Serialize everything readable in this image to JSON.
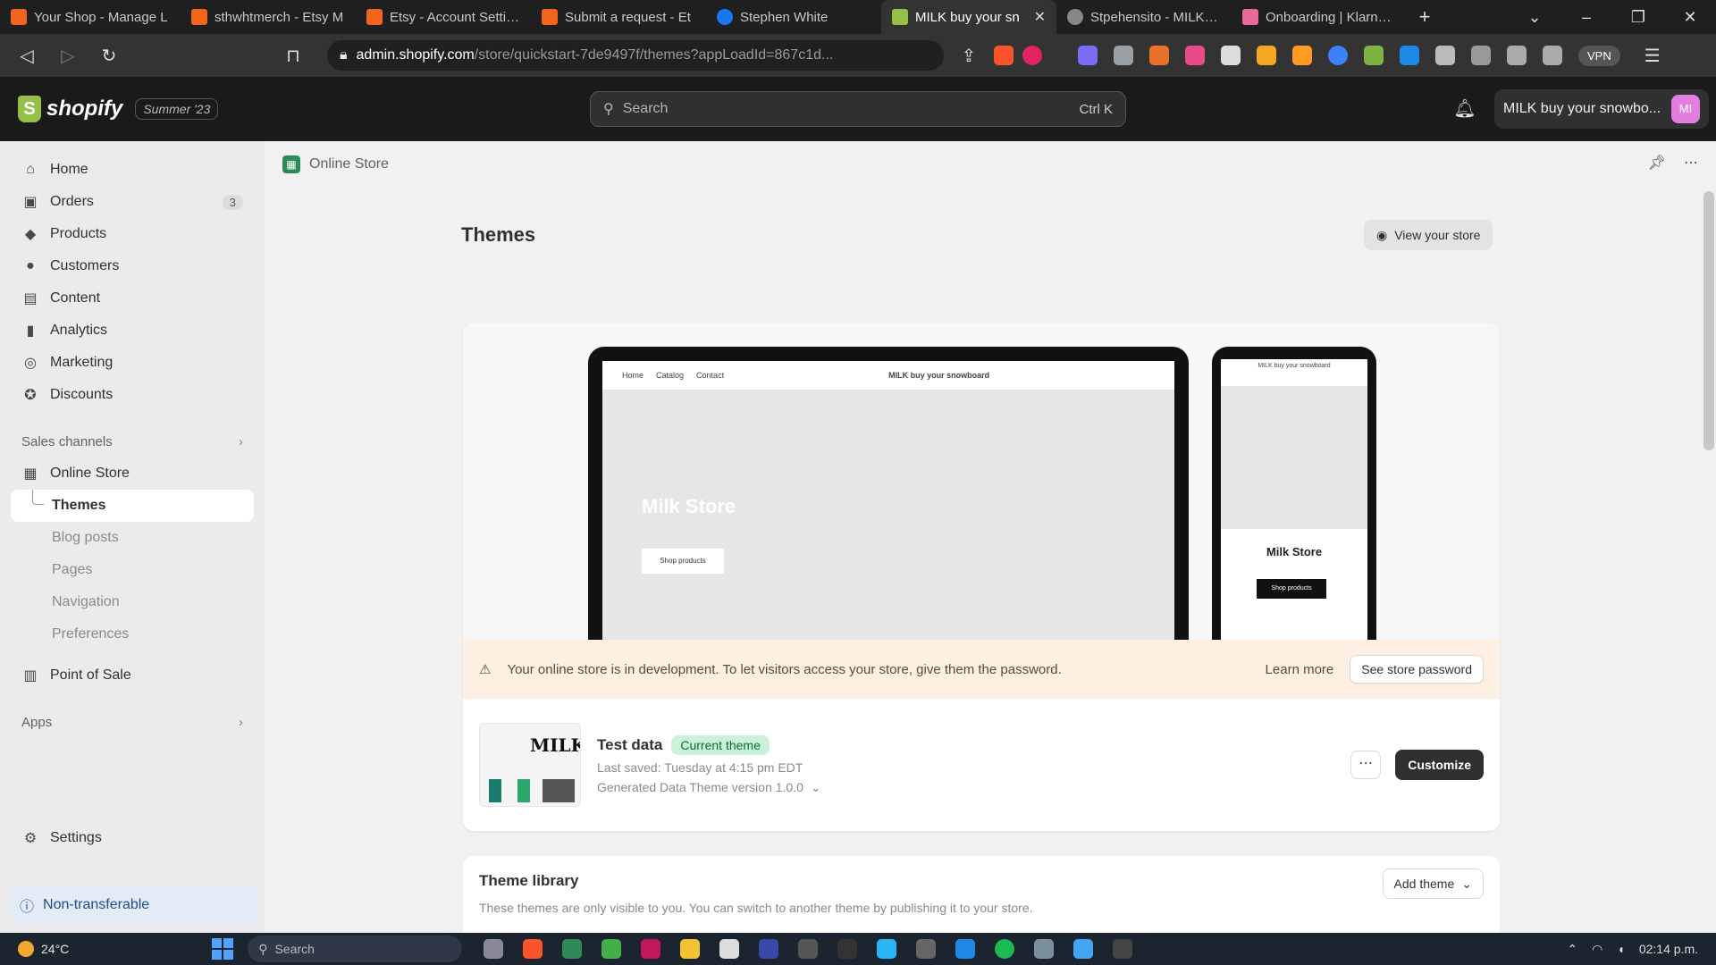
{
  "browser": {
    "tabs": [
      {
        "label": "Your Shop - Manage L",
        "color": "#f1641e",
        "active": false
      },
      {
        "label": "sthwhtmerch - Etsy M",
        "color": "#f1641e",
        "active": false
      },
      {
        "label": "Etsy - Account Settings",
        "color": "#f1641e",
        "active": false
      },
      {
        "label": "Submit a request - Et",
        "color": "#f1641e",
        "active": false
      },
      {
        "label": "Stephen White",
        "color": "#1877f2",
        "active": false
      },
      {
        "label": "MILK buy your sn",
        "color": "#95bf47",
        "active": true
      },
      {
        "label": "Stpehensito - MILK bu",
        "color": "#888888",
        "active": false
      },
      {
        "label": "Onboarding | Klarna M",
        "color": "#e8699a",
        "active": false
      }
    ],
    "url_host": "admin.shopify.com",
    "url_path": "/store/quickstart-7de9497f/themes?appLoadId=867c1d...",
    "vpn_label": "VPN"
  },
  "topbar": {
    "brand": "shopify",
    "edition_badge": "Summer '23",
    "search_placeholder": "Search",
    "search_shortcut": "Ctrl K",
    "store_name": "MILK buy your snowbo...",
    "avatar_initials": "MI"
  },
  "sidebar": {
    "items": [
      {
        "label": "Home",
        "icon": "⌂"
      },
      {
        "label": "Orders",
        "icon": "▣",
        "count": "3"
      },
      {
        "label": "Products",
        "icon": "◆"
      },
      {
        "label": "Customers",
        "icon": "●"
      },
      {
        "label": "Content",
        "icon": "▤"
      },
      {
        "label": "Analytics",
        "icon": "▮"
      },
      {
        "label": "Marketing",
        "icon": "◎"
      },
      {
        "label": "Discounts",
        "icon": "✪"
      }
    ],
    "sales_channels_label": "Sales channels",
    "online_store_label": "Online Store",
    "online_store_subitems": [
      "Themes",
      "Blog posts",
      "Pages",
      "Navigation",
      "Preferences"
    ],
    "point_of_sale_label": "Point of Sale",
    "apps_label": "Apps",
    "settings_label": "Settings",
    "non_transferable_label": "Non-transferable"
  },
  "main": {
    "breadcrumb": "Online Store",
    "title": "Themes",
    "view_store_label": "View your store",
    "preview": {
      "laptop_nav_items": [
        "Home",
        "Catalog",
        "Contact"
      ],
      "store_title": "MILK buy your snowboard",
      "hero_title": "Milk Store",
      "hero_button": "Shop products",
      "phone_store_title": "MILK buy your snowboard",
      "phone_hero_title": "Milk Store",
      "phone_button": "Shop products"
    },
    "dev_banner": {
      "message": "Your online store is in development. To let visitors access your store, give them the password.",
      "learn_more": "Learn more",
      "button": "See store password"
    },
    "current_theme": {
      "thumb_logo": "MILK",
      "name": "Test data",
      "badge": "Current theme",
      "last_saved": "Last saved: Tuesday at 4:15 pm EDT",
      "version": "Generated Data Theme version 1.0.0",
      "customize_label": "Customize"
    },
    "library": {
      "title": "Theme library",
      "description": "These themes are only visible to you. You can switch to another theme by publishing it to your store.",
      "add_theme_label": "Add theme"
    }
  },
  "taskbar": {
    "temperature": "24°C",
    "search_placeholder": "Search",
    "time": "02:14 p.m."
  }
}
